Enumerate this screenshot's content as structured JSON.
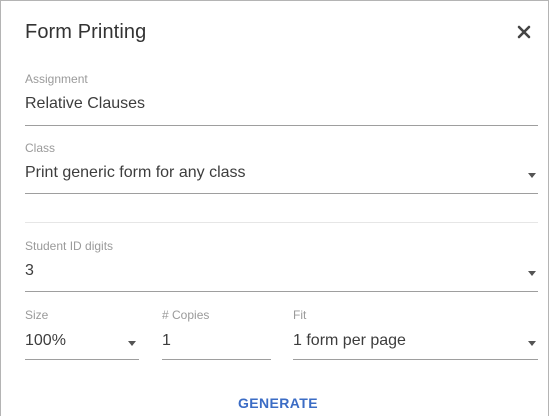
{
  "dialog": {
    "title": "Form Printing",
    "close_icon": "close-icon"
  },
  "assignment": {
    "label": "Assignment",
    "value": "Relative Clauses"
  },
  "class_select": {
    "label": "Class",
    "value": "Print generic form for any class",
    "icon": "caret-down-icon"
  },
  "student_id": {
    "label": "Student ID digits",
    "value": "3",
    "icon": "caret-down-icon"
  },
  "size": {
    "label": "Size",
    "value": "100%",
    "icon": "caret-down-icon"
  },
  "copies": {
    "label": "# Copies",
    "value": "1"
  },
  "fit": {
    "label": "Fit",
    "value": "1 form per page",
    "icon": "caret-down-icon"
  },
  "actions": {
    "generate_label": "GENERATE",
    "generate_color": "#3b6cc5"
  }
}
